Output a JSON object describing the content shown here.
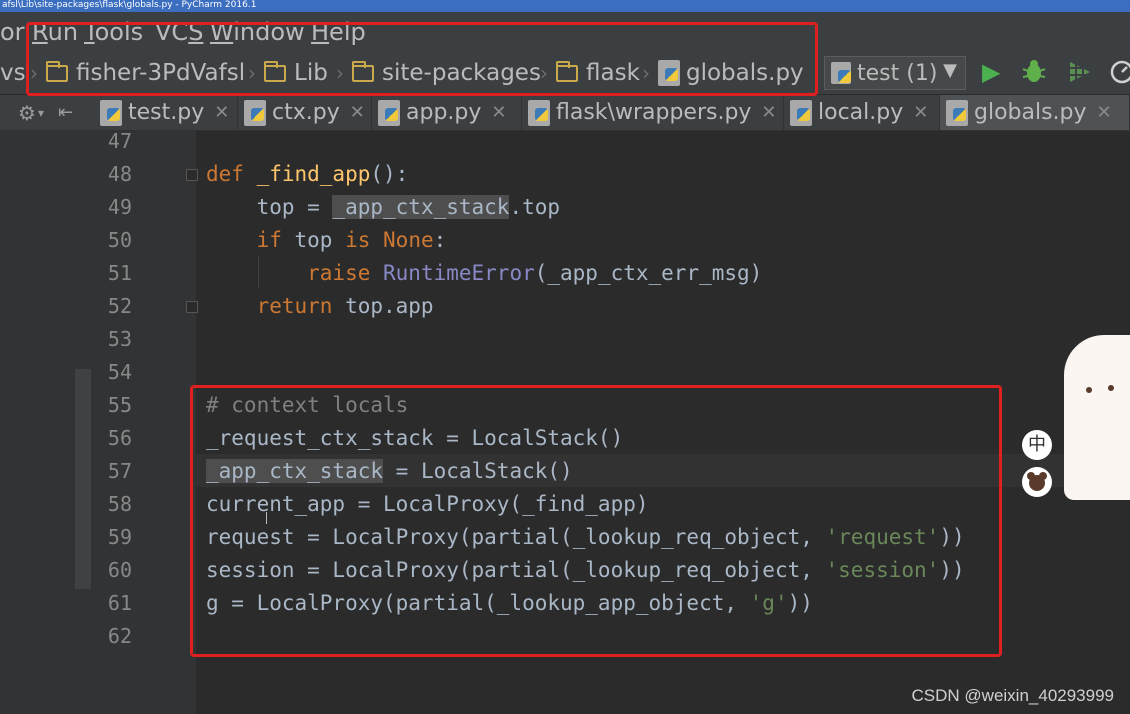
{
  "window": {
    "title": "afsl\\Lib\\site-packages\\flask\\globals.py - PyCharm 2016.1"
  },
  "menu": {
    "items": [
      {
        "label": "or",
        "mnemonic": ""
      },
      {
        "label": "Run",
        "mnemonic": "R"
      },
      {
        "label": "Tools",
        "mnemonic": "T"
      },
      {
        "label": "VCS",
        "mnemonic": "S"
      },
      {
        "label": "Window",
        "mnemonic": "W"
      },
      {
        "label": "Help",
        "mnemonic": "H"
      }
    ]
  },
  "breadcrumb": {
    "lead": "vs",
    "items": [
      "fisher-3PdVafsl",
      "Lib",
      "site-packages",
      "flask",
      "globals.py"
    ]
  },
  "toolbar": {
    "run_config": "test (1)",
    "run_icon": "play-icon",
    "debug_icon": "bug-icon",
    "coverage_icon": "coverage-icon"
  },
  "tabs": [
    {
      "label": "test.py"
    },
    {
      "label": "ctx.py"
    },
    {
      "label": "app.py"
    },
    {
      "label": "flask\\wrappers.py"
    },
    {
      "label": "local.py"
    },
    {
      "label": "globals.py",
      "active": true
    }
  ],
  "editor": {
    "line_numbers": [
      "47",
      "48",
      "49",
      "50",
      "51",
      "52",
      "53",
      "54",
      "55",
      "56",
      "57",
      "58",
      "59",
      "60",
      "61",
      "62"
    ],
    "code": {
      "l48": {
        "kw": "def ",
        "fn": "_find_app",
        "rest": "():"
      },
      "l49": {
        "pre": "    top = ",
        "hl": "_app_ctx_stack",
        "rest": ".top"
      },
      "l50": {
        "kw1": "    if ",
        "mid": "top ",
        "kw2": "is ",
        "kw3": "None",
        "rest": ":"
      },
      "l51": {
        "kw": "        raise ",
        "bi": "RuntimeError",
        "rest": "(_app_ctx_err_msg)"
      },
      "l52": {
        "kw": "    return ",
        "rest": "top.app"
      },
      "l55": {
        "cm": "# context locals"
      },
      "l56": {
        "text": "_request_ctx_stack = LocalStack()"
      },
      "l57": {
        "hl": "_app_ctx_stack",
        "rest": " = LocalStack()"
      },
      "l58": {
        "text": "current_app = LocalProxy(_find_app)"
      },
      "l59": {
        "pre": "request = LocalProxy(partial(_lookup_req_object, ",
        "str": "'request'",
        "rest": "))"
      },
      "l60": {
        "pre": "session = LocalProxy(partial(_lookup_req_object, ",
        "str": "'session'",
        "rest": "))"
      },
      "l61": {
        "pre": "g = LocalProxy(partial(_lookup_app_object, ",
        "str": "'g'",
        "rest": "))"
      }
    }
  },
  "overlay": {
    "ime_label": "中",
    "watermark": "CSDN @weixin_40293999",
    "annotation_color": "#e02020"
  }
}
